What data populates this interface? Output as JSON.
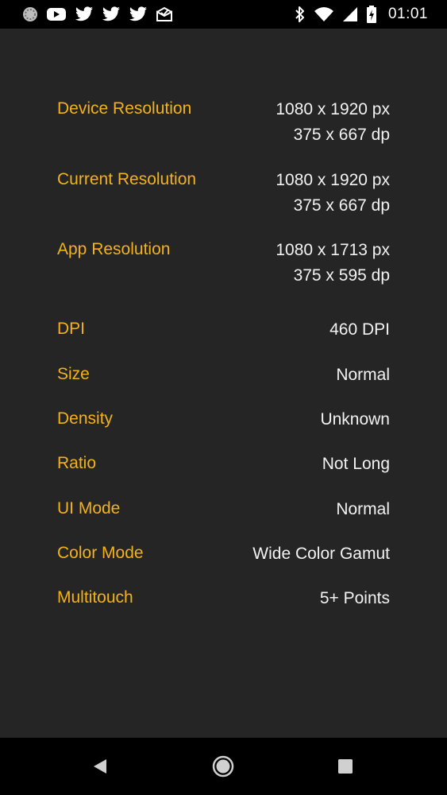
{
  "status_bar": {
    "time": "01:01",
    "left_icons": [
      "spinner-notification-icon",
      "youtube-icon",
      "twitter-icon",
      "twitter-icon",
      "twitter-icon",
      "mail-check-icon"
    ],
    "right_icons": [
      "bluetooth-icon",
      "wifi-icon",
      "signal-icon",
      "battery-charging-icon"
    ]
  },
  "rows": [
    {
      "label": "Device Resolution",
      "value_line1": "1080 x 1920 px",
      "value_line2": "375 x 667 dp"
    },
    {
      "label": "Current Resolution",
      "value_line1": "1080 x 1920 px",
      "value_line2": "375 x 667 dp"
    },
    {
      "label": "App Resolution",
      "value_line1": "1080 x 1713 px",
      "value_line2": "375 x 595 dp"
    },
    {
      "label": "DPI",
      "value": "460 DPI"
    },
    {
      "label": "Size",
      "value": "Normal"
    },
    {
      "label": "Density",
      "value": "Unknown"
    },
    {
      "label": "Ratio",
      "value": "Not Long"
    },
    {
      "label": "UI Mode",
      "value": "Normal"
    },
    {
      "label": "Color Mode",
      "value": "Wide Color Gamut"
    },
    {
      "label": "Multitouch",
      "value": "5+ Points"
    }
  ],
  "colors": {
    "label": "#f3b21b",
    "value": "#f2f2f2",
    "background": "#252525",
    "bars": "#000000"
  },
  "nav_bar": {
    "buttons": [
      "back-icon",
      "home-icon",
      "recents-icon"
    ]
  }
}
